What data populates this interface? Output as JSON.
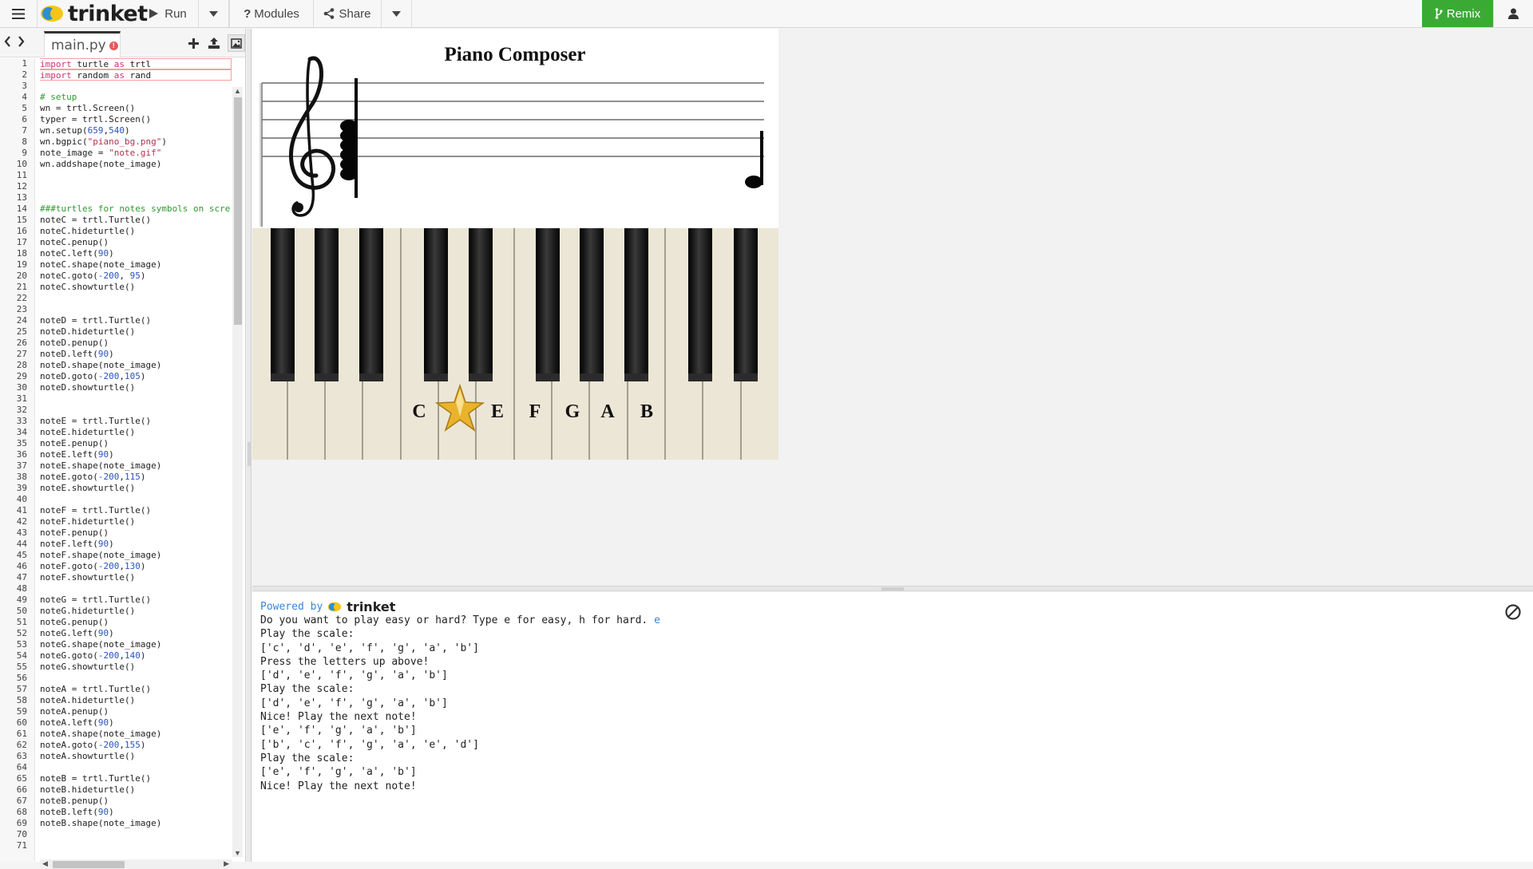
{
  "toolbar": {
    "logo_text": "trinket",
    "run_label": "Run",
    "modules_label": "Modules",
    "share_label": "Share",
    "remix_label": "Remix"
  },
  "editor": {
    "file_name": "main.py",
    "error_badge": "!",
    "line_numbers": [
      "1",
      "2",
      "3",
      "4",
      "5",
      "6",
      "7",
      "8",
      "9",
      "10",
      "11",
      "12",
      "13",
      "14",
      "15",
      "16",
      "17",
      "18",
      "19",
      "20",
      "21",
      "22",
      "23",
      "24",
      "25",
      "26",
      "27",
      "28",
      "29",
      "30",
      "31",
      "32",
      "33",
      "34",
      "35",
      "36",
      "37",
      "38",
      "39",
      "40",
      "41",
      "42",
      "43",
      "44",
      "45",
      "46",
      "47",
      "48",
      "49",
      "50",
      "51",
      "52",
      "53",
      "54",
      "55",
      "56",
      "57",
      "58",
      "59",
      "60",
      "61",
      "62",
      "63",
      "64",
      "65",
      "66",
      "67",
      "68",
      "69",
      "70",
      "71"
    ],
    "code_lines": [
      "import turtle as trtl",
      "import random as rand",
      "",
      "# setup",
      "wn = trtl.Screen()",
      "typer = trtl.Screen()",
      "wn.setup(659,540)",
      "wn.bgpic(\"piano_bg.png\")",
      "note_image = \"note.gif\"",
      "wn.addshape(note_image)",
      "",
      "",
      "",
      "###turtles for notes symbols on scre",
      "noteC = trtl.Turtle()",
      "noteC.hideturtle()",
      "noteC.penup()",
      "noteC.left(90)",
      "noteC.shape(note_image)",
      "noteC.goto(-200, 95)",
      "noteC.showturtle()",
      "",
      "",
      "noteD = trtl.Turtle()",
      "noteD.hideturtle()",
      "noteD.penup()",
      "noteD.left(90)",
      "noteD.shape(note_image)",
      "noteD.goto(-200,105)",
      "noteD.showturtle()",
      "",
      "",
      "noteE = trtl.Turtle()",
      "noteE.hideturtle()",
      "noteE.penup()",
      "noteE.left(90)",
      "noteE.shape(note_image)",
      "noteE.goto(-200,115)",
      "noteE.showturtle()",
      "",
      "noteF = trtl.Turtle()",
      "noteF.hideturtle()",
      "noteF.penup()",
      "noteF.left(90)",
      "noteF.shape(note_image)",
      "noteF.goto(-200,130)",
      "noteF.showturtle()",
      "",
      "noteG = trtl.Turtle()",
      "noteG.hideturtle()",
      "noteG.penup()",
      "noteG.left(90)",
      "noteG.shape(note_image)",
      "noteG.goto(-200,140)",
      "noteG.showturtle()",
      "",
      "noteA = trtl.Turtle()",
      "noteA.hideturtle()",
      "noteA.penup()",
      "noteA.left(90)",
      "noteA.shape(note_image)",
      "noteA.goto(-200,155)",
      "noteA.showturtle()",
      "",
      "noteB = trtl.Turtle()",
      "noteB.hideturtle()",
      "noteB.penup()",
      "noteB.left(90)",
      "noteB.shape(note_image)",
      "",
      ""
    ]
  },
  "canvas": {
    "title": "Piano Composer",
    "key_labels": [
      "C",
      "E",
      "F",
      "G",
      "A",
      "B"
    ]
  },
  "console": {
    "powered_by_label": "Powered by",
    "powered_by_logo": "trinket",
    "prompt_line": "Do you want to play easy or hard? Type e for easy, h for hard. ",
    "user_input": "e",
    "output_lines": [
      "Play the scale:",
      "['c', 'd', 'e', 'f', 'g', 'a', 'b']",
      "Press the letters up above!",
      "['d', 'e', 'f', 'g', 'a', 'b']",
      "Play the scale:",
      "['d', 'e', 'f', 'g', 'a', 'b']",
      "Nice! Play the next note!",
      "['e', 'f', 'g', 'a', 'b']",
      "['b', 'c', 'f', 'g', 'a', 'e', 'd']",
      "Play the scale:",
      "['e', 'f', 'g', 'a', 'b']",
      "Nice! Play the next note!"
    ]
  },
  "colors": {
    "remix_green": "#3aaa35",
    "console_blue": "#3a86d6",
    "key_ivory": "#ece6d6"
  },
  "icons": {
    "menu": "hamburger-icon",
    "run": "play-icon",
    "modules": "question-icon",
    "share": "share-icon",
    "remix": "branch-icon",
    "user": "user-icon",
    "clear": "ban-icon"
  }
}
